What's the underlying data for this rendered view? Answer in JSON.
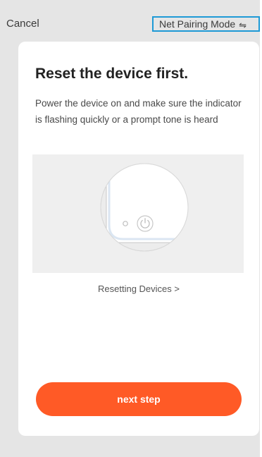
{
  "header": {
    "cancel_label": "Cancel",
    "mode_label": "Net Pairing Mode",
    "mode_icon": "⇋"
  },
  "main": {
    "title": "Reset the device first.",
    "description": "Power the device on and make sure the indicator is flashing quickly or a prompt tone is heard",
    "reset_link_label": "Resetting Devices >",
    "next_button_label": "next step"
  },
  "colors": {
    "accent_button": "#ff5a26",
    "highlight_border": "#1e9ad6",
    "background": "#e5e5e5",
    "card": "#ffffff"
  },
  "icons": {
    "mode": "swap-arrows-icon",
    "power": "power-icon",
    "indicator": "indicator-light-icon"
  }
}
